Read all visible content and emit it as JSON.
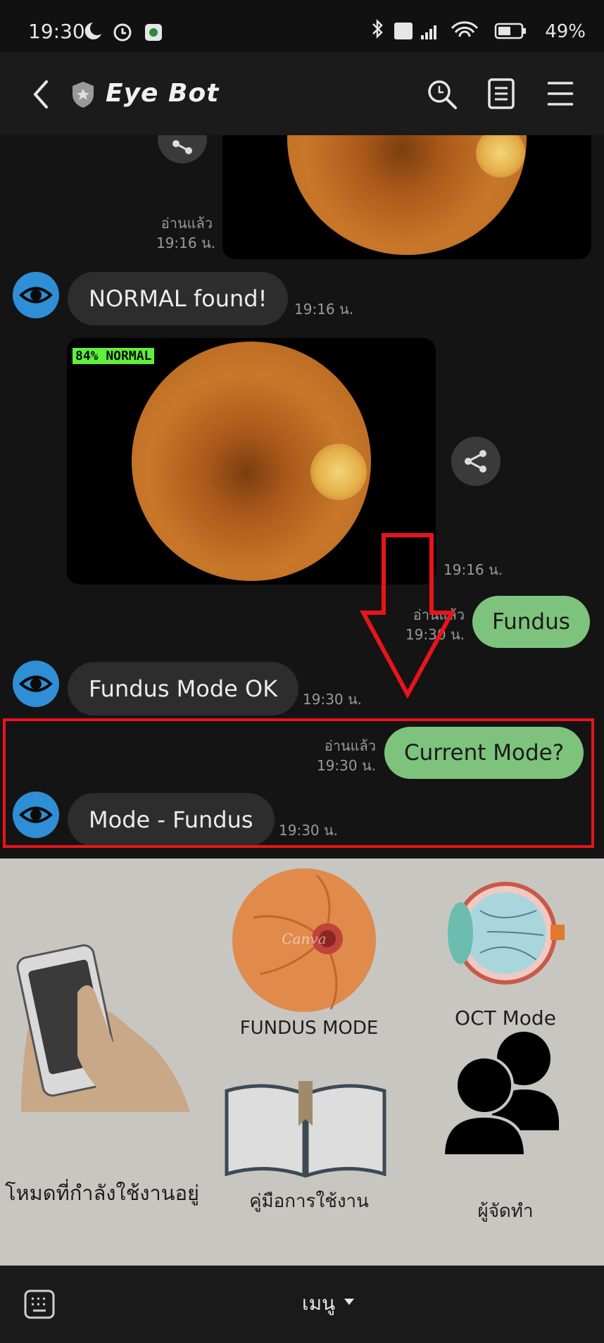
{
  "status_bar": {
    "time": "19:30",
    "battery": "49%"
  },
  "header": {
    "title": "Eye Bot"
  },
  "messages": {
    "m0": {
      "read": "อ่านแล้ว",
      "time": "19:16 น."
    },
    "m1": {
      "text": "NORMAL found!",
      "time": "19:16 น."
    },
    "m2": {
      "label": "84% NORMAL",
      "time": "19:16 น."
    },
    "m3": {
      "text": "Fundus",
      "read": "อ่านแล้ว",
      "time": "19:30 น."
    },
    "m4": {
      "text": "Fundus Mode OK",
      "time": "19:30 น."
    },
    "m5": {
      "text": "Current Mode?",
      "read": "อ่านแล้ว",
      "time": "19:30 น."
    },
    "m6": {
      "text": "Mode - Fundus",
      "time": "19:30 น."
    }
  },
  "menu": {
    "fundus": "FUNDUS MODE",
    "fundus_watermark": "Canva",
    "oct": "OCT Mode",
    "current_mode": "โหมดที่กำลังใช้งานอยู่",
    "manual": "คู่มือการใช้งาน",
    "creators": "ผู้จัดทำ"
  },
  "bottom_bar": {
    "menu_label": "เมนู"
  },
  "colors": {
    "outgoing_bubble": "#7dc37c",
    "incoming_bubble": "#2d2d2d",
    "avatar": "#2e8fd6",
    "annotation_red": "#e8141c",
    "menu_background": "#c8c6c1"
  },
  "icons": [
    "back-icon",
    "shield-icon",
    "search-icon",
    "notes-icon",
    "hamburger-icon",
    "eye-icon",
    "share-icon",
    "keyboard-icon",
    "caret-down-icon"
  ]
}
